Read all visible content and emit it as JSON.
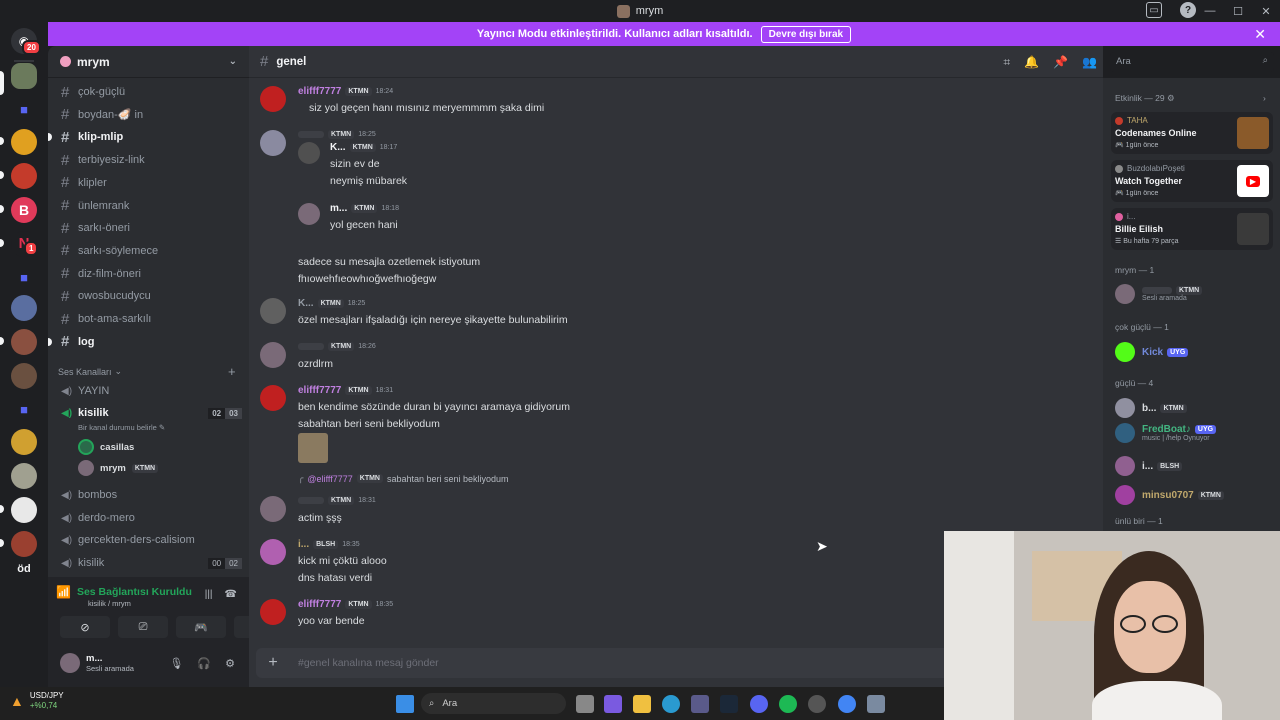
{
  "window": {
    "title": "mrym"
  },
  "banner": {
    "text": "Yayıncı Modu etkinleştirildi. Kullanıcı adları kısaltıldı.",
    "button": "Devre dışı bırak"
  },
  "servers": {
    "home_badge": "20",
    "server_badge": "1",
    "od_label": "öd"
  },
  "guild": {
    "name": "mrym"
  },
  "channels": {
    "text": [
      {
        "name": "çok-güçlü",
        "bold": false
      },
      {
        "name": "boydan-🦪 in",
        "bold": false
      },
      {
        "name": "klip-mlip",
        "bold": true
      },
      {
        "name": "terbiyesiz-link",
        "bold": false
      },
      {
        "name": "klipler",
        "bold": false
      },
      {
        "name": "ünlemrank",
        "bold": false
      },
      {
        "name": "sarkı-öneri",
        "bold": false
      },
      {
        "name": "sarkı-söylemece",
        "bold": false
      },
      {
        "name": "diz-film-öneri",
        "bold": false
      },
      {
        "name": "owosbucudycu",
        "bold": false
      },
      {
        "name": "bot-ama-sarkılı",
        "bold": false
      },
      {
        "name": "log",
        "bold": true
      }
    ],
    "voice_category": "Ses Kanalları",
    "voice": [
      {
        "name": "YAYIN"
      },
      {
        "name": "kisilik",
        "count_a": "02",
        "count_b": "03",
        "status": "Bir kanal durumu belirle"
      },
      {
        "name": "bombos"
      },
      {
        "name": "derdo-mero"
      },
      {
        "name": "gercekten-ders-calisiom"
      },
      {
        "name": "kisilik",
        "count_a": "00",
        "count_b": "02"
      }
    ],
    "voice_users": [
      {
        "name": "casillas",
        "tag": ""
      },
      {
        "name": "mrym",
        "tag": "KTMN"
      }
    ]
  },
  "voice_panel": {
    "status": "Ses Bağlantısı Kuruldu",
    "sub": "kisilik / mrym",
    "user_name": "m...",
    "user_status": "Sesli aramada"
  },
  "chat": {
    "channel": "genel",
    "search_placeholder": "Ara",
    "composer_placeholder": "#genel kanalına mesaj gönder",
    "messages": [
      {
        "user": "elifff7777",
        "tag": "KTMN",
        "time": "18:24",
        "lines": [
          "siz yol geçen hanı mısınız meryemmmm şaka dimi"
        ]
      },
      {
        "user": "",
        "tag": "KTMN",
        "time": "18:25",
        "lines": []
      },
      {
        "user": "K...",
        "tag": "KTMN",
        "time": "18:17",
        "lines": [
          "sizin ev de",
          "neymiş mübarek"
        ]
      },
      {
        "user": "m...",
        "tag": "KTMN",
        "time": "18:18",
        "lines": [
          "yol gecen hani"
        ]
      },
      {
        "user": "",
        "tag": "",
        "time": "",
        "lines": [
          "sadece su mesajla ozetlemek istiyotum",
          "fhıowehfıeowhıoğwefhıoğegw"
        ]
      },
      {
        "user": "K...",
        "tag": "KTMN",
        "time": "18:25",
        "lines": [
          "özel mesajları ifşaladığı için nereye şikayette bulunabilirim"
        ]
      },
      {
        "user": "",
        "tag": "KTMN",
        "time": "18:26",
        "lines": [
          "ozrdlrm"
        ]
      },
      {
        "user": "elifff7777",
        "tag": "KTMN",
        "time": "18:31",
        "lines": [
          "ben kendime sözünde duran bi yayıncı aramaya gidiyorum",
          "sabahtan beri seni bekliyodum"
        ]
      },
      {
        "reply_user": "@elifff7777",
        "reply_tag": "KTMN",
        "reply_text": "sabahtan beri seni bekliyodum",
        "user": "",
        "tag": "KTMN",
        "time": "18:31",
        "lines": [
          "actim şşş"
        ]
      },
      {
        "user": "i...",
        "tag": "BLSH",
        "time": "18:35",
        "lines": [
          "kick mi çöktü alooo",
          "dns hatası verdi"
        ]
      },
      {
        "user": "elifff7777",
        "tag": "KTMN",
        "time": "18:35",
        "lines": [
          "yoo var bende"
        ]
      }
    ]
  },
  "members": {
    "activity_title": "Etkinlik — 29",
    "activities": [
      {
        "user": "TAHA",
        "title": "Codenames Online",
        "sub": "1gün önce"
      },
      {
        "user": "BuzdolabıPoşeti",
        "title": "Watch Together",
        "sub": "1gün önce"
      },
      {
        "user": "i...",
        "title": "Billie Eilish",
        "sub": "Bu hafta 79 parça"
      }
    ],
    "groups": [
      {
        "title": "mrym — 1",
        "members": [
          {
            "name": "",
            "tag": "KTMN",
            "sub": "Sesli aramada",
            "color": "#949ba4"
          }
        ]
      },
      {
        "title": "çok güçlü — 1",
        "members": [
          {
            "name": "Kick",
            "tag": "UYG",
            "sub": "",
            "color": "#7289da"
          }
        ]
      },
      {
        "title": "güçlü — 4",
        "members": [
          {
            "name": "b...",
            "tag": "KTMN",
            "sub": "",
            "color": "#dbdee1"
          },
          {
            "name": "FredBoat♪",
            "tag": "UYG",
            "sub": "music | /help Oynuyor",
            "color": "#43b581"
          },
          {
            "name": "i...",
            "tag": "BLSH",
            "sub": "",
            "color": "#dbdee1"
          },
          {
            "name": "minsu0707",
            "tag": "KTMN",
            "sub": "",
            "color": "#c0a86c"
          }
        ]
      },
      {
        "title": "ünlü biri — 1",
        "members": []
      }
    ]
  },
  "taskbar": {
    "ticker": "USD/JPY",
    "ticker_value": "+%0,74",
    "search": "Ara"
  }
}
